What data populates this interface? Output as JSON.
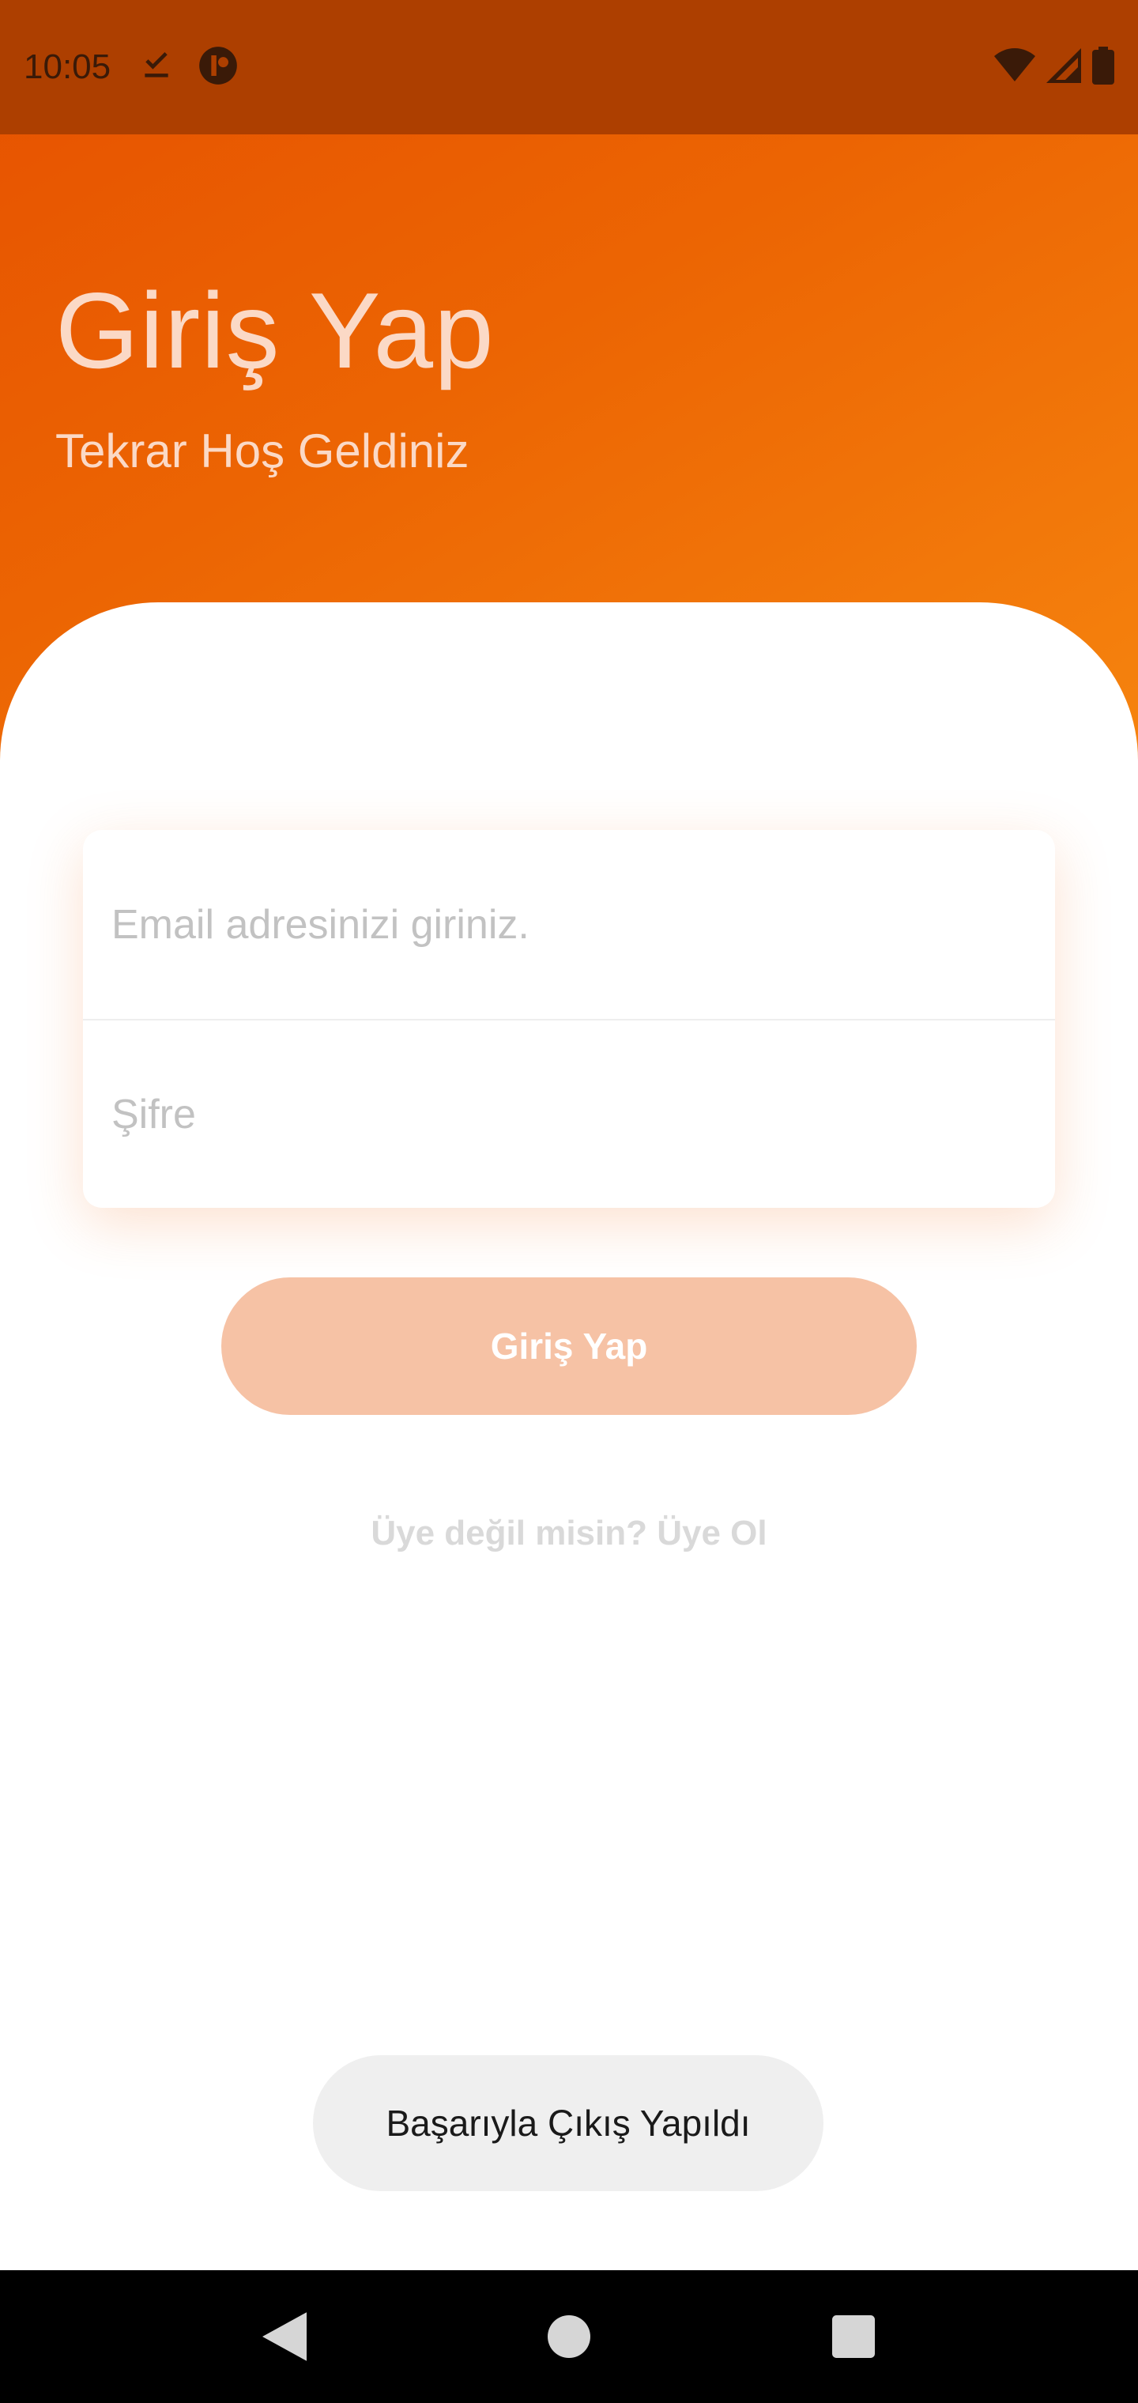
{
  "status_bar": {
    "time": "10:05",
    "left_icons": [
      "download-done-icon",
      "app-notification-icon"
    ],
    "right_icons": [
      "wifi-icon",
      "cell-signal-icon",
      "battery-icon"
    ]
  },
  "header": {
    "title": "Giriş Yap",
    "subtitle": "Tekrar Hoş Geldiniz"
  },
  "form": {
    "email_placeholder": "Email adresinizi giriniz.",
    "password_placeholder": "Şifre",
    "login_button": "Giriş Yap",
    "signup_link": "Üye değil misin? Üye Ol"
  },
  "toast": {
    "message": "Başarıyla Çıkış Yapıldı"
  },
  "nav_bar": {
    "buttons": [
      "back-icon",
      "home-icon",
      "recents-icon"
    ]
  },
  "colors": {
    "accent": "#e65100",
    "accent_light": "#f6850f",
    "status_bar": "#ad3f00",
    "button_disabled": "#f6c2a5"
  }
}
